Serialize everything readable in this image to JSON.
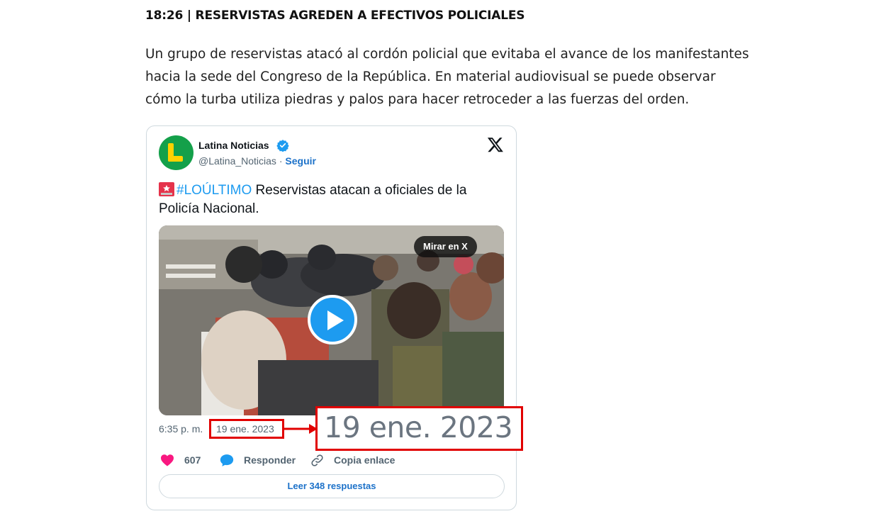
{
  "article": {
    "headline": "18:26 | RESERVISTAS AGREDEN A EFECTIVOS POLICIALES",
    "paragraph": "Un grupo de reservistas atacó al cordón policial que evitaba el avance de los manifestantes hacia la sede del Congreso de la República. En material audiovisual se puede observar cómo la turba utiliza piedras y palos para hacer retroceder a las fuerzas del orden."
  },
  "tweet": {
    "author_name": "Latina Noticias",
    "handle": "@Latina_Noticias",
    "separator": " · ",
    "follow_label": "Seguir",
    "hashtag": "#LOÚLTIMO",
    "text": " Reservistas atacan a oficiales de la Policía Nacional.",
    "watch_label": "Mirar en X",
    "time": "6:35 p. m.",
    "date": "19 ene. 2023",
    "likes": "607",
    "reply_label": "Responder",
    "copy_label": "Copia enlace",
    "read_replies_label": "Leer 348 respuestas"
  },
  "annotation": {
    "zoom_text": "19 ene. 2023",
    "highlight_color": "#e10000"
  },
  "icons": {
    "verified": "verified-badge-icon",
    "x_logo": "x-logo-icon",
    "alarm": "police-light-icon",
    "play": "play-icon",
    "heart": "heart-icon",
    "reply": "speech-bubble-icon",
    "link": "link-icon"
  }
}
